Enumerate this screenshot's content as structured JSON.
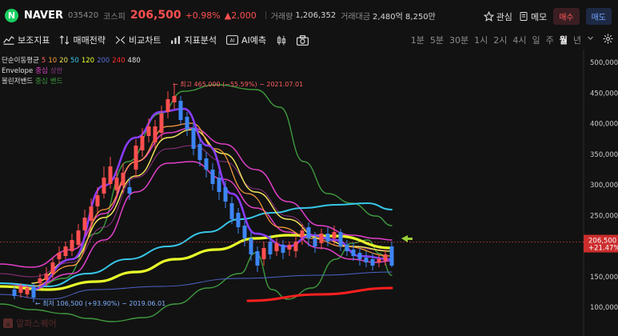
{
  "header": {
    "logo_letter": "N",
    "name": "NAVER",
    "code": "035420",
    "market": "코스피",
    "price": "206,500",
    "change_pct": "+0.98%",
    "change_abs": "▲2,000",
    "volume_label": "거래량",
    "volume": "1,206,352",
    "amount_label": "거래대금",
    "amount": "2,480억 8,250만",
    "watch_label": "관심",
    "memo_label": "메모",
    "buy_label": "매수",
    "sell_label": "매도"
  },
  "toolbar": {
    "tools": [
      "보조지표",
      "매매전략",
      "비교차트",
      "지표분석",
      "AI예측"
    ],
    "periods": [
      "1분",
      "5분",
      "30분",
      "1시",
      "2시",
      "4시",
      "일",
      "주",
      "월",
      "년"
    ],
    "active_period": "월"
  },
  "indicators": {
    "ma": {
      "title": "단순이동평균",
      "periods": [
        "5",
        "10",
        "20",
        "50",
        "120",
        "200",
        "240",
        "480"
      ]
    },
    "envelope": {
      "title": "Envelope",
      "items": [
        "중심",
        "상한"
      ]
    },
    "bollinger": {
      "title": "볼린저밴드",
      "items": [
        "중심",
        "밴드"
      ]
    }
  },
  "annotations": {
    "high": "← 최고 465,000 (−55.59%) − 2021.07.01",
    "low": "← 최저 106,500 (+93.90%) − 2019.06.01"
  },
  "watermark": "알파스퀘어",
  "colors": {
    "up": "#ff4f4f",
    "down": "#3d86f5",
    "ma5": "#ff5f5f",
    "ma10": "#ff9e3d",
    "ma20": "#f1e35a",
    "ma50": "#37c6e8",
    "ma120": "#e8ff2a",
    "ma200": "#4e63c9",
    "ma240": "#ff1f1f",
    "ma480": "#e0e0e0",
    "envelope": "#e040c8",
    "bollinger": "#3f9a3f"
  },
  "chart_data": {
    "type": "line",
    "title": "",
    "xlabel": "",
    "ylabel": "",
    "ylim": [
      100000,
      500000
    ],
    "y_ticks": [
      "500,000",
      "450,000",
      "400,000",
      "350,000",
      "300,000",
      "250,000",
      "200,000",
      "150,000",
      "100,000"
    ],
    "y_tick_values": [
      500000,
      450000,
      400000,
      350000,
      300000,
      250000,
      200000,
      150000,
      100000
    ],
    "current_price_label": "206,500",
    "current_change_label": "+21.47%",
    "current_price": 206500
  }
}
